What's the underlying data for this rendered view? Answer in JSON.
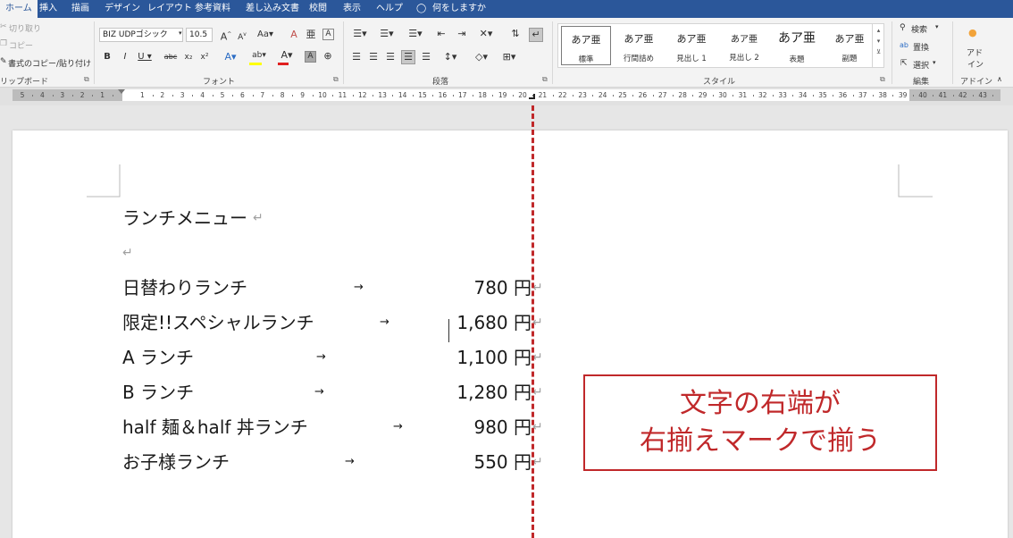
{
  "ribbon": {
    "tabs": [
      "ホーム",
      "挿入",
      "描画",
      "デザイン",
      "レイアウト",
      "参考資料",
      "差し込み文書",
      "校閲",
      "表示",
      "ヘルプ"
    ],
    "tell_me": "何をしますか",
    "clipboard": {
      "cut": "切り取り",
      "copy": "コピー",
      "format_painter": "書式のコピー/貼り付け",
      "group_label": "リップボード"
    },
    "font": {
      "font_name": "BIZ UDPゴシック",
      "font_size": "10.5",
      "group_label": "フォント"
    },
    "paragraph": {
      "group_label": "段落"
    },
    "styles": {
      "items": [
        {
          "sample": "あア亜",
          "name": "標準"
        },
        {
          "sample": "あア亜",
          "name": "行間詰め"
        },
        {
          "sample": "あア亜",
          "name": "見出し 1"
        },
        {
          "sample": "あア亜",
          "name": "見出し 2"
        },
        {
          "sample": "あア亜",
          "name": "表題"
        },
        {
          "sample": "あア亜",
          "name": "副題"
        }
      ],
      "group_label": "スタイル"
    },
    "editing": {
      "find": "検索",
      "replace": "置換",
      "select": "選択",
      "group_label": "編集"
    },
    "addins": {
      "button_line1": "アド",
      "button_line2": "イン",
      "group_label": "アドイン"
    }
  },
  "ruler": {
    "labels": [
      "5",
      "4",
      "3",
      "2",
      "1",
      "1",
      "2",
      "3",
      "4",
      "5",
      "6",
      "7",
      "8",
      "9",
      "10",
      "11",
      "12",
      "13",
      "14",
      "15",
      "16",
      "17",
      "18",
      "19",
      "20",
      "21",
      "22",
      "23",
      "24",
      "25",
      "26",
      "27",
      "28",
      "29",
      "30",
      "31",
      "32",
      "33",
      "34",
      "35",
      "36",
      "37",
      "38",
      "39",
      "40",
      "41",
      "42",
      "43"
    ]
  },
  "document": {
    "title": "ランチメニュー",
    "items": [
      {
        "name": "日替わりランチ",
        "arrow": "→",
        "price": "780 円"
      },
      {
        "name": "限定!!スペシャルランチ",
        "arrow": "→",
        "price": "1,680 円"
      },
      {
        "name": "A ランチ",
        "arrow": "→",
        "price": "1,100 円"
      },
      {
        "name": "B ランチ",
        "arrow": "→",
        "price": "1,280 円"
      },
      {
        "name": "half 麺＆half 丼ランチ",
        "arrow": "→",
        "price": "980 円"
      },
      {
        "name": "お子様ランチ",
        "arrow": "→",
        "price": "550 円"
      }
    ],
    "paragraph_mark": "↵"
  },
  "annotation": {
    "line1": "文字の右端が",
    "line2": "右揃えマークで揃う",
    "color": "#c0282a"
  }
}
